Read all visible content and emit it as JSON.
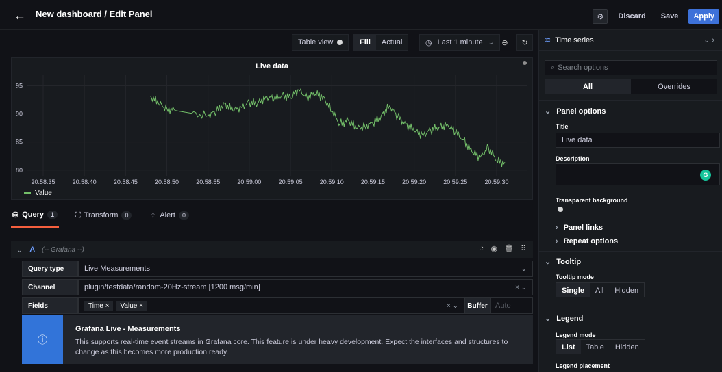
{
  "header": {
    "title": "New dashboard / Edit Panel",
    "discard_label": "Discard",
    "save_label": "Save",
    "apply_label": "Apply"
  },
  "toolbar": {
    "table_view_label": "Table view",
    "fill_label": "Fill",
    "actual_label": "Actual",
    "time_range": "Last 1 minute"
  },
  "panel": {
    "title": "Live data",
    "legend_value": "Value"
  },
  "chart_data": {
    "type": "line",
    "title": "Live data",
    "x_ticks": [
      "20:58:35",
      "20:58:40",
      "20:58:45",
      "20:58:50",
      "20:58:55",
      "20:59:00",
      "20:59:05",
      "20:59:10",
      "20:59:15",
      "20:59:20",
      "20:59:25",
      "20:59:30"
    ],
    "y_ticks": [
      80,
      85,
      90,
      95
    ],
    "ylim": [
      79,
      97
    ],
    "series": [
      {
        "name": "Value",
        "color": "#73bf69",
        "x": [
          "20:58:48",
          "20:58:49",
          "20:58:50",
          "20:58:51",
          "20:58:53",
          "20:58:55",
          "20:58:56",
          "20:58:57",
          "20:58:58",
          "20:58:59",
          "20:59:00",
          "20:59:01",
          "20:59:02",
          "20:59:03",
          "20:59:04",
          "20:59:05",
          "20:59:06",
          "20:59:07",
          "20:59:08",
          "20:59:09",
          "20:59:10",
          "20:59:11",
          "20:59:12",
          "20:59:13",
          "20:59:14",
          "20:59:15",
          "20:59:16",
          "20:59:17",
          "20:59:18",
          "20:59:19",
          "20:59:20",
          "20:59:21",
          "20:59:22",
          "20:59:23",
          "20:59:24",
          "20:59:25",
          "20:59:26",
          "20:59:27",
          "20:59:28",
          "20:59:29",
          "20:59:30",
          "20:59:31"
        ],
        "values": [
          93.2,
          91.8,
          91.0,
          90.6,
          90.1,
          89.7,
          90.4,
          91.9,
          90.6,
          91.2,
          92.1,
          91.8,
          93.1,
          92.6,
          93.4,
          92.8,
          94.3,
          93.0,
          93.5,
          93.1,
          90.4,
          88.2,
          88.9,
          87.4,
          87.9,
          88.3,
          89.7,
          91.4,
          89.5,
          88.2,
          86.9,
          86.3,
          87.1,
          87.6,
          88.2,
          86.7,
          85.4,
          83.2,
          82.3,
          84.1,
          81.6,
          81.4
        ]
      }
    ]
  },
  "tabs": {
    "query": {
      "label": "Query",
      "count": "1"
    },
    "transform": {
      "label": "Transform",
      "count": "0"
    },
    "alert": {
      "label": "Alert",
      "count": "0"
    }
  },
  "query": {
    "name": "A",
    "datasource": "(-- Grafana --)",
    "query_type_label": "Query type",
    "query_type_value": "Live Measurements",
    "channel_label": "Channel",
    "channel_value": "plugin/testdata/random-20Hz-stream [1200 msg/min]",
    "fields_label": "Fields",
    "fields": [
      "Time",
      "Value"
    ],
    "buffer_label": "Buffer",
    "buffer_placeholder": "Auto"
  },
  "info": {
    "title": "Grafana Live - Measurements",
    "text": "This supports real-time event streams in Grafana core. This feature is under heavy development. Expect the interfaces and structures to change as this becomes more production ready."
  },
  "options": {
    "visualization": "Time series",
    "search_placeholder": "Search options",
    "tab_all": "All",
    "tab_overrides": "Overrides",
    "panel_options": "Panel options",
    "title_label": "Title",
    "title_value": "Live data",
    "description_label": "Description",
    "transparent_label": "Transparent background",
    "panel_links": "Panel links",
    "repeat_options": "Repeat options",
    "tooltip": "Tooltip",
    "tooltip_mode_label": "Tooltip mode",
    "tooltip_modes": [
      "Single",
      "All",
      "Hidden"
    ],
    "legend": "Legend",
    "legend_mode_label": "Legend mode",
    "legend_modes": [
      "List",
      "Table",
      "Hidden"
    ],
    "legend_placement_label": "Legend placement"
  }
}
